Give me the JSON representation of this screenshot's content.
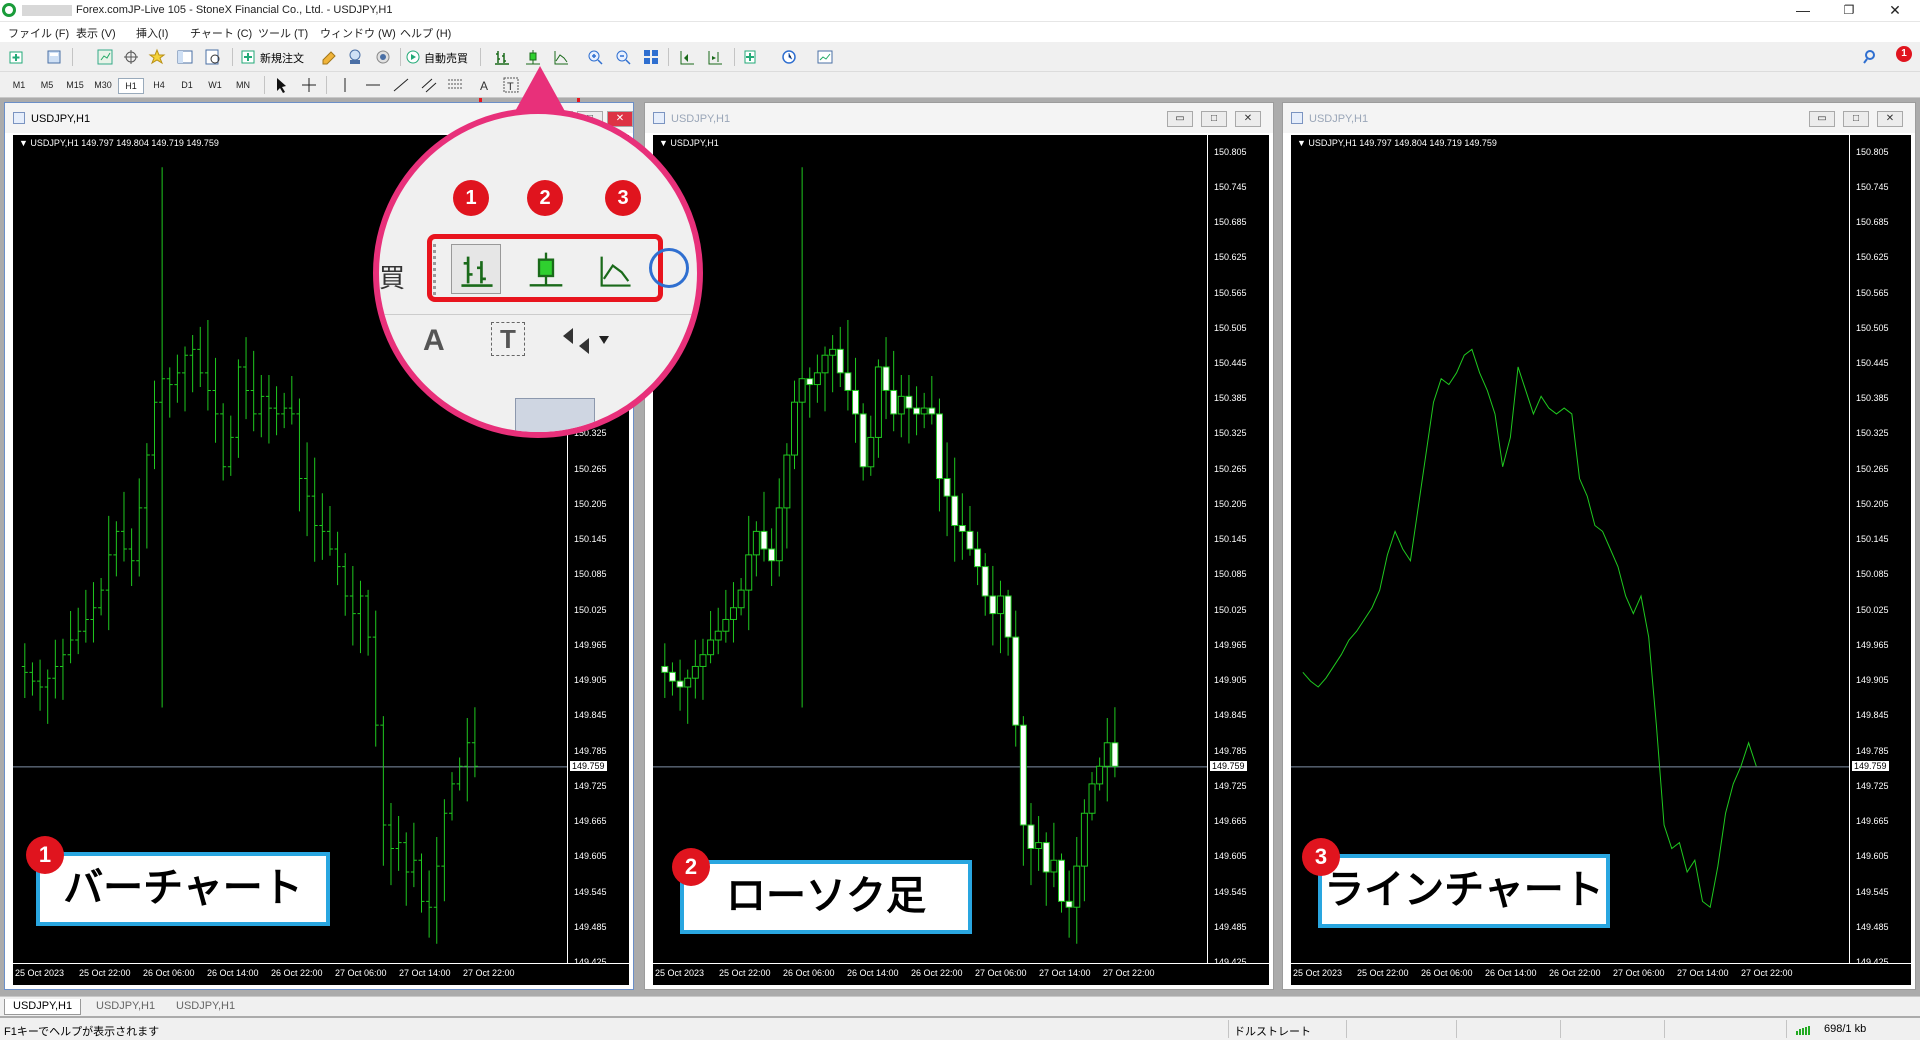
{
  "window": {
    "title": "Forex.comJP-Live 105 - StoneX Financial Co., Ltd. - USDJPY,H1",
    "minimize": "—",
    "restore": "❐",
    "close": "✕"
  },
  "menu": [
    "ファイル (F)",
    "表示 (V)",
    "挿入(I)",
    "チャート (C)",
    "ツール (T)",
    "ウィンドウ (W)",
    "ヘルプ (H)"
  ],
  "toolbar": {
    "new_order": "新規注文",
    "auto_trade": "自動売買",
    "alert_badge": "1"
  },
  "timeframes": [
    "M1",
    "M5",
    "M15",
    "M30",
    "H1",
    "H4",
    "D1",
    "W1",
    "MN"
  ],
  "active_timeframe": "H1",
  "charts": [
    {
      "title": "USDJPY,H1",
      "info": "USDJPY,H1  149.797 149.804 149.719 149.759",
      "label": "バーチャート",
      "badge": "1",
      "type": "bar"
    },
    {
      "title": "USDJPY,H1",
      "info": "USDJPY,H1",
      "label": "ローソク足",
      "badge": "2",
      "type": "candle"
    },
    {
      "title": "USDJPY,H1",
      "info": "USDJPY,H1  149.797 149.804 149.719 149.759",
      "label": "ラインチャート",
      "badge": "3",
      "type": "line"
    }
  ],
  "price_labels": [
    "150.805",
    "150.745",
    "150.685",
    "150.625",
    "150.565",
    "150.505",
    "150.445",
    "150.385",
    "150.325",
    "150.265",
    "150.205",
    "150.145",
    "150.085",
    "150.025",
    "149.965",
    "149.905",
    "149.845",
    "149.785",
    "149.725",
    "149.665",
    "149.605",
    "149.545",
    "149.485",
    "149.425"
  ],
  "current_price": "149.759",
  "time_labels": [
    "25 Oct 2023",
    "25 Oct 22:00",
    "26 Oct 06:00",
    "26 Oct 14:00",
    "26 Oct 22:00",
    "27 Oct 06:00",
    "27 Oct 14:00",
    "27 Oct 22:00"
  ],
  "zoom_badges": [
    "1",
    "2",
    "3"
  ],
  "zoom_text": {
    "buy_char": "買",
    "text_icon": "A",
    "textlabel_icon": "T"
  },
  "tabs": [
    "USDJPY,H1",
    "USDJPY,H1",
    "USDJPY,H1"
  ],
  "status": {
    "help": "F1キーでヘルプが表示されます",
    "profile": "ドルストレート",
    "traffic": "698/1 kb"
  },
  "colors": {
    "bar_green": "#1fc81f",
    "candle_bull": "#000000",
    "candle_bear": "#ffffff",
    "highlight_red": "#e8141e",
    "callout_blue": "#29a6e0",
    "zoom_ring": "#e8307a"
  },
  "chart_data": {
    "type": "bar",
    "symbol": "USDJPY",
    "timeframe": "H1",
    "ylim": [
      149.425,
      150.835
    ],
    "close_series": [
      149.92,
      149.905,
      149.895,
      149.91,
      149.93,
      149.95,
      149.975,
      149.99,
      150.01,
      150.03,
      150.06,
      150.12,
      150.16,
      150.13,
      150.11,
      150.2,
      150.29,
      150.38,
      150.42,
      150.41,
      150.43,
      150.46,
      150.47,
      150.43,
      150.4,
      150.36,
      150.27,
      150.32,
      150.44,
      150.4,
      150.36,
      150.39,
      150.37,
      150.36,
      150.37,
      150.36,
      150.25,
      150.22,
      150.17,
      150.16,
      150.13,
      150.1,
      150.05,
      150.02,
      150.05,
      149.98,
      149.83,
      149.66,
      149.62,
      149.63,
      149.58,
      149.6,
      149.53,
      149.52,
      149.59,
      149.68,
      149.73,
      149.76,
      149.8,
      149.76
    ]
  }
}
